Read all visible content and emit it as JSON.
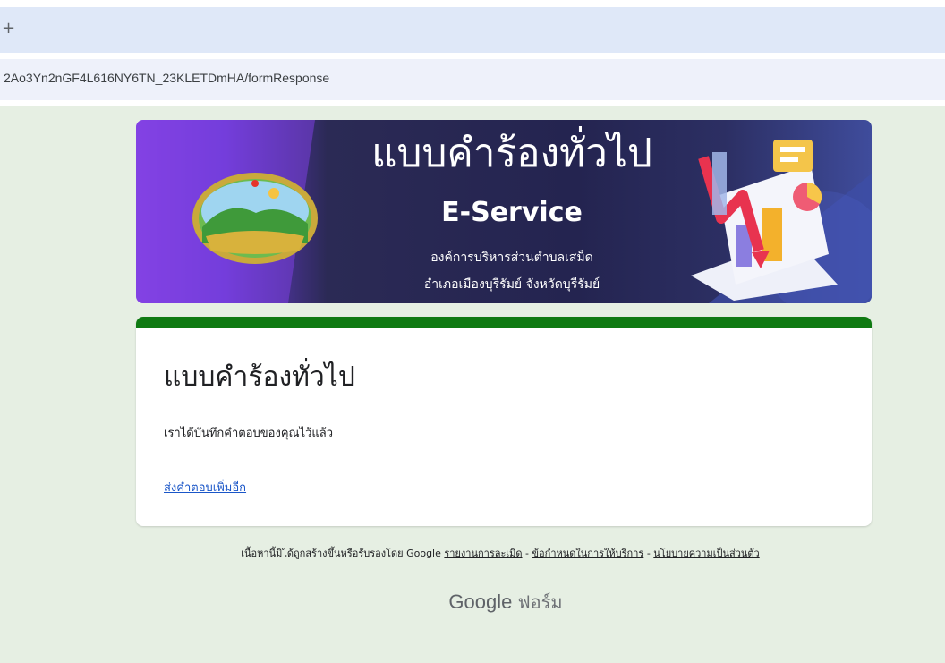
{
  "browser": {
    "new_tab_glyph": "+",
    "url": "2Ao3Yn2nGF4L616NY6TN_23KLETDmHA/formResponse"
  },
  "banner": {
    "title": "แบบคำร้องทั่วไป",
    "subtitle": "E-Service",
    "organization": "องค์การบริหารส่วนตำบลเสม็ด",
    "district": "อำเภอเมืองบุรีรัมย์ จังหวัดบุรีรัมย์",
    "logo": "sub-district-emblem-logo",
    "illustration": "growth-chart-illustration",
    "colors": {
      "purple": "#8c45e8",
      "navy": "#242450",
      "accent_red": "#e8334f"
    }
  },
  "form": {
    "title": "แบบคำร้องทั่วไป",
    "confirmation": "เราได้บันทึกคำตอบของคุณไว้แล้ว",
    "submit_another_link": "ส่งคำตอบเพิ่มอีก",
    "accent_color": "#0f7a12"
  },
  "footer": {
    "disclaimer": "เนื้อหานี้มิได้ถูกสร้างขึ้นหรือรับรองโดย Google",
    "links": [
      "รายงานการละเมิด",
      "ข้อกำหนดในการให้บริการ",
      "นโยบายความเป็นส่วนตัว"
    ],
    "separator": "-",
    "brand": "Google",
    "brand_suffix": "ฟอร์ม"
  }
}
